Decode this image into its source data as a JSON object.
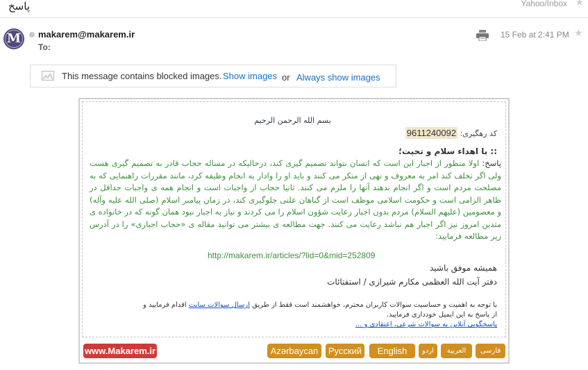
{
  "header": {
    "subject": "پاسخ",
    "folder": "Yahoo/Inbox",
    "star_top": "★"
  },
  "message": {
    "sender": "makarem@makarem.ir",
    "to_label": "To:",
    "avatar_letter": "M",
    "datetime": "15 Feb at 2:41 PM",
    "star": "★"
  },
  "blocked_bar": {
    "text": "This message contains blocked images.",
    "show_images": "Show images",
    "or": "or",
    "always_show": "Always show images"
  },
  "email_body": {
    "basmala": "بسم الله الرحمن الرحیم",
    "tracking_label": "کد رهگیری:",
    "tracking_code": "9611240092",
    "greeting": ":: با اهداء سلام و تحیت؛",
    "answer_label": "پاسخ:",
    "answer_text": "اولا منظور از اجبار این است که انسان نتواند تصمیم گیری کند، درحالیکه در مساله حجاب قادر به تصمیم گیری هست ولی اگر تخلف کند امر به معروف و نهی از منکر می کنند و باید او را وادار به انجام وظیفه کرد، مانند مقررات راهنمایی که به مصلحت مردم است و اگر انجام ندهند آنها را ملزم می کنند. ثانیا حجاب از واجبات است و انجام همه ی واجبات حداقل در ظاهر الزامی است و حکومت اسلامی موظف است از گناهان علنی جلوگیری کند، در زمان پیامبر اسلام (صلی الله علیه وآله) و معصومین (علیهم السلام) مردم بدون اجبار رعایت شؤون اسلام را می کردند و نیاز به اجبار نبود همان گونه که در خانواده ی متدین امروز نیز اگر اجبار هم نباشد رعایت می کنند. جهت مطالعه ی بیشتر می توانید مقاله ی «حجاب اجباری» را در آدرس زیر مطالعه فرمایید:",
    "url": "http://makarem.ir/articles/?lid=0&mid=252809",
    "success": "همیشه موفق باشید",
    "office": "دفتر آیت الله العظمی مکارم شیرازی / استفتائات",
    "notice_text_1": "با توجه به اهمیت و حساسیت سوالات کاربران محترم، خواهشمند است فقط از طریق",
    "notice_link_1": "ارسال سوالات سایت",
    "notice_text_2": "اقدام فرمایید و از پاسخ به این ایمیل خودداری فرمایید.",
    "notice_link_2": "پاسخگویی آنلاین به سوالات شرعی، اعتقادی و ..."
  },
  "languages": {
    "site": "www.Makarem.ir",
    "azerbaijani": "Azərbaycan",
    "russian": "Русский",
    "english": "English",
    "urdu": "اردو",
    "arabic": "العربية",
    "farsi": "فارسی"
  },
  "colors": {
    "link_blue": "#1a6ec9",
    "answer_green": "#3f8d3f",
    "lang_orange": "#d08f20",
    "site_red": "#cf3b3b"
  }
}
